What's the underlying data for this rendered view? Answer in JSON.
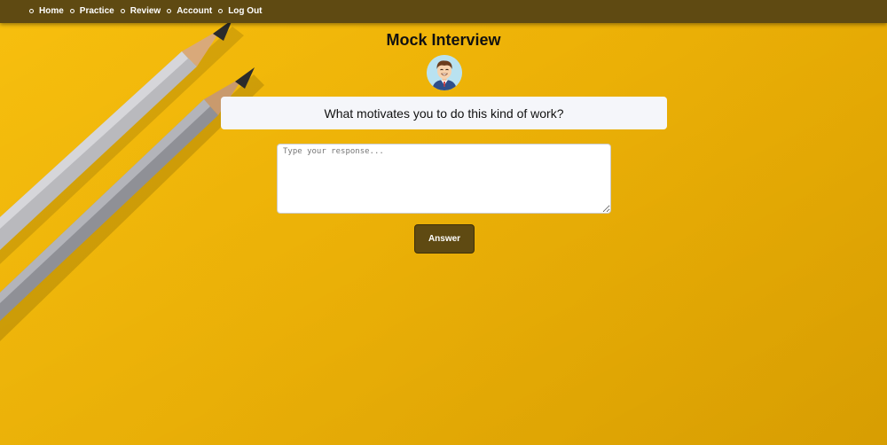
{
  "nav": {
    "items": [
      {
        "label": "Home"
      },
      {
        "label": "Practice"
      },
      {
        "label": "Review"
      },
      {
        "label": "Account"
      },
      {
        "label": "Log Out"
      }
    ]
  },
  "page": {
    "title": "Mock Interview"
  },
  "avatar": {
    "icon": "interviewer-avatar-icon"
  },
  "question": {
    "text": "What motivates you to do this kind of work?"
  },
  "response": {
    "placeholder": "Type your response...",
    "value": ""
  },
  "actions": {
    "answer_label": "Answer"
  },
  "colors": {
    "background": "#f4b707",
    "navbar": "#5f4a12",
    "button": "#5f4a12",
    "question_box": "#f5f6fa"
  }
}
